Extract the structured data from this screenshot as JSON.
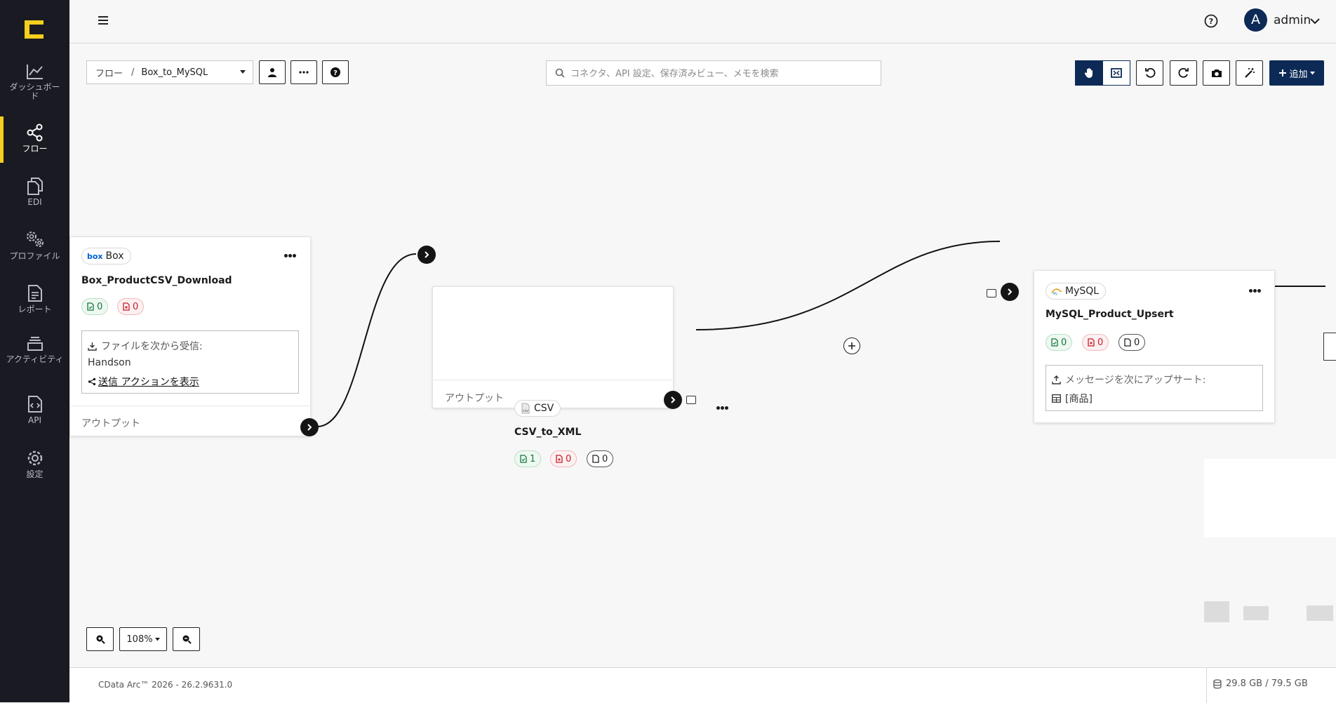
{
  "sidebar": {
    "logo": "cdata-logo",
    "items": [
      {
        "label": "ダッシュボード",
        "icon": "chart-line-icon"
      },
      {
        "label": "フロー",
        "icon": "share-nodes-icon",
        "active": true
      },
      {
        "label": "EDI",
        "icon": "documents-icon"
      },
      {
        "label": "プロファイル",
        "icon": "gears-icon"
      },
      {
        "label": "レポート",
        "icon": "report-icon"
      },
      {
        "label": "アクティビティ",
        "icon": "stack-icon"
      },
      {
        "label": "API",
        "icon": "api-file-icon"
      },
      {
        "label": "設定",
        "icon": "gear-icon"
      }
    ]
  },
  "header": {
    "user_initial": "A",
    "user_name": "admin"
  },
  "toolbar": {
    "breadcrumb_root": "フロー",
    "breadcrumb_sep": "/",
    "breadcrumb_flow": "Box_to_MySQL",
    "search_placeholder": "コネクタ、API 設定、保存済みビュー、メモを検索",
    "add_label": "追加"
  },
  "nodes": {
    "box": {
      "type_label": "Box",
      "name": "Box_ProductCSV_Download",
      "success_count": "0",
      "error_count": "0",
      "receive_label": "ファイルを次から受信:",
      "receive_value": "Handson",
      "show_send_actions": "送信 アクションを表示",
      "output_label": "アウトプット"
    },
    "csv": {
      "type_label": "CSV",
      "name": "CSV_to_XML",
      "success_count": "1",
      "error_count": "0",
      "pending_count": "0",
      "output_label": "アウトプット"
    },
    "mysql": {
      "type_label": "MySQL",
      "name": "MySQL_Product_Upsert",
      "success_count": "0",
      "error_count": "0",
      "pending_count": "0",
      "upsert_label": "メッセージを次にアップサート:",
      "upsert_table": "[商品]"
    }
  },
  "zoom": {
    "level": "108%"
  },
  "footer": {
    "version": "CData Arc™ 2026 - 26.2.9631.0",
    "disk": "29.8 GB / 79.5 GB"
  },
  "colors": {
    "sidebar_bg": "#1a1a22",
    "accent_yellow": "#f4cf1e",
    "primary": "#0d2a56",
    "success": "#127a3c",
    "error": "#c51f2a"
  }
}
